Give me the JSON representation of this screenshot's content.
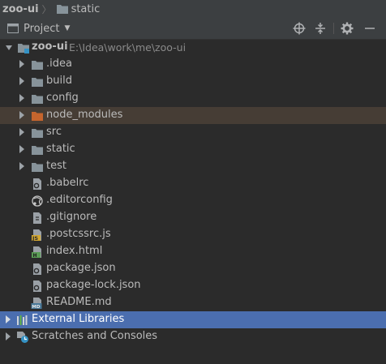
{
  "breadcrumb": {
    "project": "zoo-ui",
    "folder": "static"
  },
  "panel": {
    "view_label": "Project",
    "tools": [
      "locate-icon",
      "collapse-all-icon",
      "settings-icon",
      "hide-icon"
    ]
  },
  "tree": {
    "root": {
      "name": "zoo-ui",
      "path": "E:\\Idea\\work\\me\\zoo-ui"
    },
    "folders": [
      ".idea",
      "build",
      "config",
      "node_modules",
      "src",
      "static",
      "test"
    ],
    "files": [
      {
        "name": ".babelrc",
        "icon": "config-file-icon"
      },
      {
        "name": ".editorconfig",
        "icon": "editorconfig-file-icon"
      },
      {
        "name": ".gitignore",
        "icon": "ignore-file-icon"
      },
      {
        "name": ".postcssrc.js",
        "icon": "js-file-icon"
      },
      {
        "name": "index.html",
        "icon": "html-file-icon"
      },
      {
        "name": "package.json",
        "icon": "json-file-icon"
      },
      {
        "name": "package-lock.json",
        "icon": "json-file-icon"
      },
      {
        "name": "README.md",
        "icon": "markdown-file-icon"
      }
    ],
    "external_libraries": "External Libraries",
    "scratches": "Scratches and Consoles"
  },
  "colors": {
    "background": "#2b2b2b",
    "folder": "#87939a",
    "excluded_folder": "#c5652d",
    "excluded_row": "#463d35",
    "selection": "#4b6eaf"
  }
}
